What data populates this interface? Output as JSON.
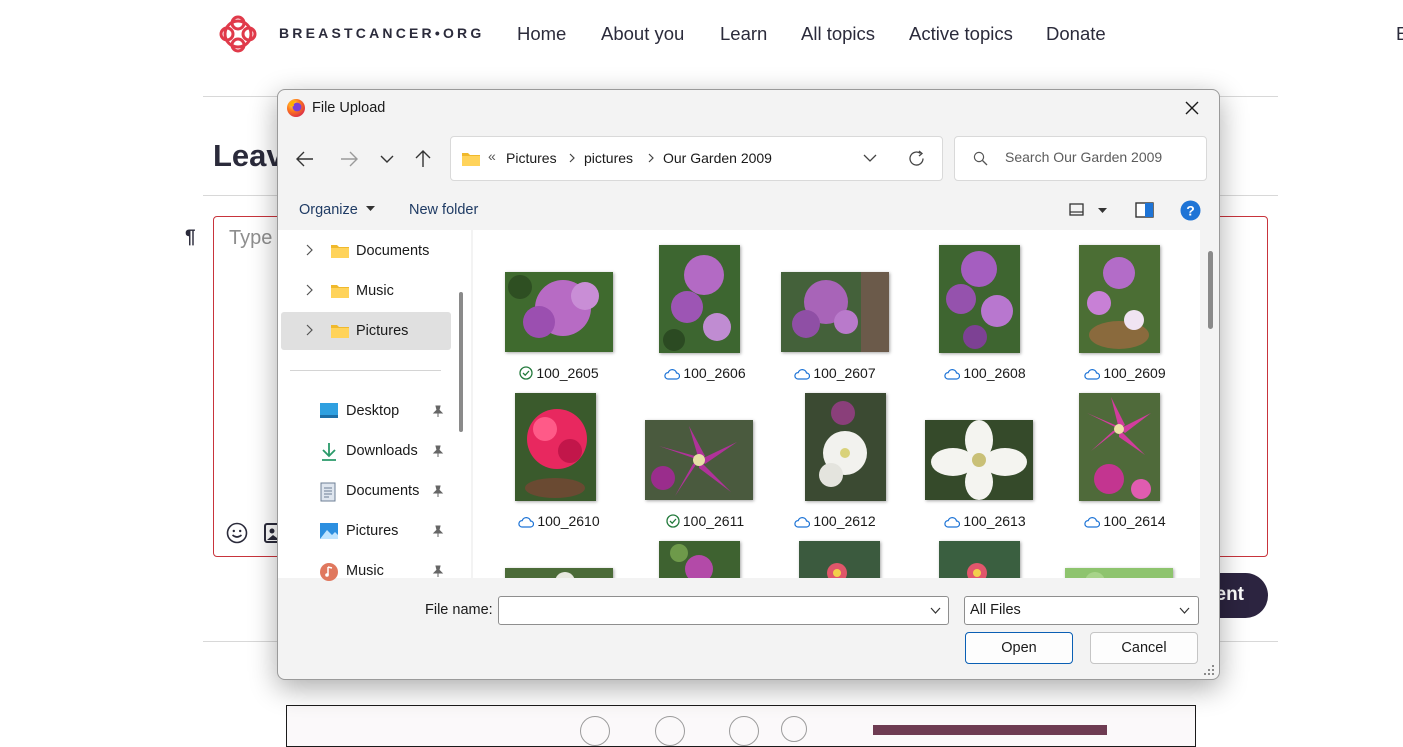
{
  "site": {
    "logo_text": "BREASTCANCER•ORG",
    "nav": [
      "Home",
      "About you",
      "Learn",
      "All topics",
      "Active topics",
      "Donate"
    ],
    "nav_edge_fragment": "E",
    "page_heading_fragment": "Leav",
    "comment_placeholder_fragment": "Type",
    "post_button_fragment": "ent",
    "colors": {
      "brand": "#e03a4a",
      "nav_text": "#2b2b3b",
      "button": "#2c2440",
      "error_border": "#c8343c"
    }
  },
  "dialog": {
    "title": "File Upload",
    "close_label": "Close",
    "breadcrumb": {
      "overflow": "«",
      "items": [
        "Pictures",
        "pictures",
        "Our Garden 2009"
      ]
    },
    "search_placeholder": "Search Our Garden 2009",
    "toolbar": {
      "organize": "Organize",
      "new_folder": "New folder"
    },
    "sidebar": {
      "tree": [
        {
          "label": "Documents",
          "selected": false
        },
        {
          "label": "Music",
          "selected": false
        },
        {
          "label": "Pictures",
          "selected": true
        }
      ],
      "quick_access": [
        {
          "label": "Desktop",
          "icon": "desktop-icon"
        },
        {
          "label": "Downloads",
          "icon": "download-icon"
        },
        {
          "label": "Documents",
          "icon": "document-icon"
        },
        {
          "label": "Pictures",
          "icon": "pictures-icon"
        },
        {
          "label": "Music",
          "icon": "music-icon"
        }
      ]
    },
    "files": [
      {
        "name": "100_2605",
        "status": "synced"
      },
      {
        "name": "100_2606",
        "status": "cloud"
      },
      {
        "name": "100_2607",
        "status": "cloud"
      },
      {
        "name": "100_2608",
        "status": "cloud"
      },
      {
        "name": "100_2609",
        "status": "cloud"
      },
      {
        "name": "100_2610",
        "status": "cloud"
      },
      {
        "name": "100_2611",
        "status": "synced"
      },
      {
        "name": "100_2612",
        "status": "cloud"
      },
      {
        "name": "100_2613",
        "status": "cloud"
      },
      {
        "name": "100_2614",
        "status": "cloud"
      }
    ],
    "file_name_label": "File name:",
    "file_name_value": "",
    "file_type": "All Files",
    "open_label": "Open",
    "cancel_label": "Cancel",
    "colors": {
      "link_text": "#1f3b64",
      "accent": "#0a5fb4",
      "help": "#1e74d6"
    }
  }
}
